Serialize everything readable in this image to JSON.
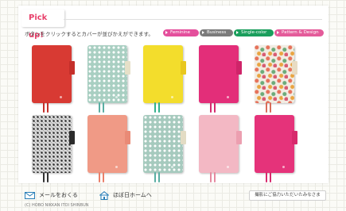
{
  "section": {
    "title": "Pick up!",
    "instruction": "ボタンをクリックするとカバーが並びかえができます。"
  },
  "filters": [
    {
      "label": "Feminine",
      "color": "#e44f9c"
    },
    {
      "label": "Business",
      "color": "#7b7b7b"
    },
    {
      "label": "Single-color",
      "color": "#1a9e5c"
    },
    {
      "label": "Pattern & Design",
      "color": "#e45b9a"
    }
  ],
  "covers": [
    {
      "name": "cover-red",
      "color": "#d83a33",
      "tab": "#c42f2a",
      "ribbon": [
        "#c42f2a",
        "#c42f2a"
      ],
      "pattern": "solid"
    },
    {
      "name": "cover-mint-dots",
      "color": "#a9cfc2",
      "tab": "#e6e0c8",
      "ribbon": [
        "#5aaea3",
        "#5aaea3"
      ],
      "pattern": "dots"
    },
    {
      "name": "cover-yellow",
      "color": "#f3dd2c",
      "tab": "#e8c71f",
      "ribbon": [
        "#33b18c",
        "#33b18c"
      ],
      "pattern": "solid"
    },
    {
      "name": "cover-pink",
      "color": "#e32e79",
      "tab": "#cf2469",
      "ribbon": [
        "#d52a6e",
        "#d52a6e"
      ],
      "pattern": "solid"
    },
    {
      "name": "cover-floral",
      "color": "#f2ece2",
      "tab": "#e8dcc4",
      "ribbon": [
        "#d96c5a",
        "#d96c5a"
      ],
      "pattern": "floral"
    },
    {
      "name": "cover-black-white-lattice",
      "color": "#d9d9d9",
      "tab": "#2b2b2b",
      "ribbon": [
        "#333333",
        "#333333"
      ],
      "pattern": "lattice"
    },
    {
      "name": "cover-salmon",
      "color": "#f09a86",
      "tab": "#e98a76",
      "ribbon": [
        "#e9806a",
        "#e9806a"
      ],
      "pattern": "solid"
    },
    {
      "name": "cover-mint-dots-2",
      "color": "#a6cabe",
      "tab": "#e3dcc4",
      "ribbon": [
        "#5aaea3",
        "#5aaea3"
      ],
      "pattern": "dots"
    },
    {
      "name": "cover-light-pink",
      "color": "#f3b8c4",
      "tab": "#ec9fb0",
      "ribbon": [
        "#e58aa0",
        "#e58aa0"
      ],
      "pattern": "solid"
    },
    {
      "name": "cover-magenta",
      "color": "#e5337a",
      "tab": "#d72a6c",
      "ribbon": [
        "#d72a6c",
        "#d72a6c"
      ],
      "pattern": "solid"
    }
  ],
  "footer": {
    "mail_label": "メールをおくる",
    "home_label": "ほぼ日ホームへ",
    "thanks_label": "撮影にご協力いただいたみなさま",
    "copyright": "(C) HOBO NIKKAN ITOI SHINBUN"
  },
  "colors": {
    "accent": "#e8416b",
    "icon": "#2a7fb8"
  }
}
